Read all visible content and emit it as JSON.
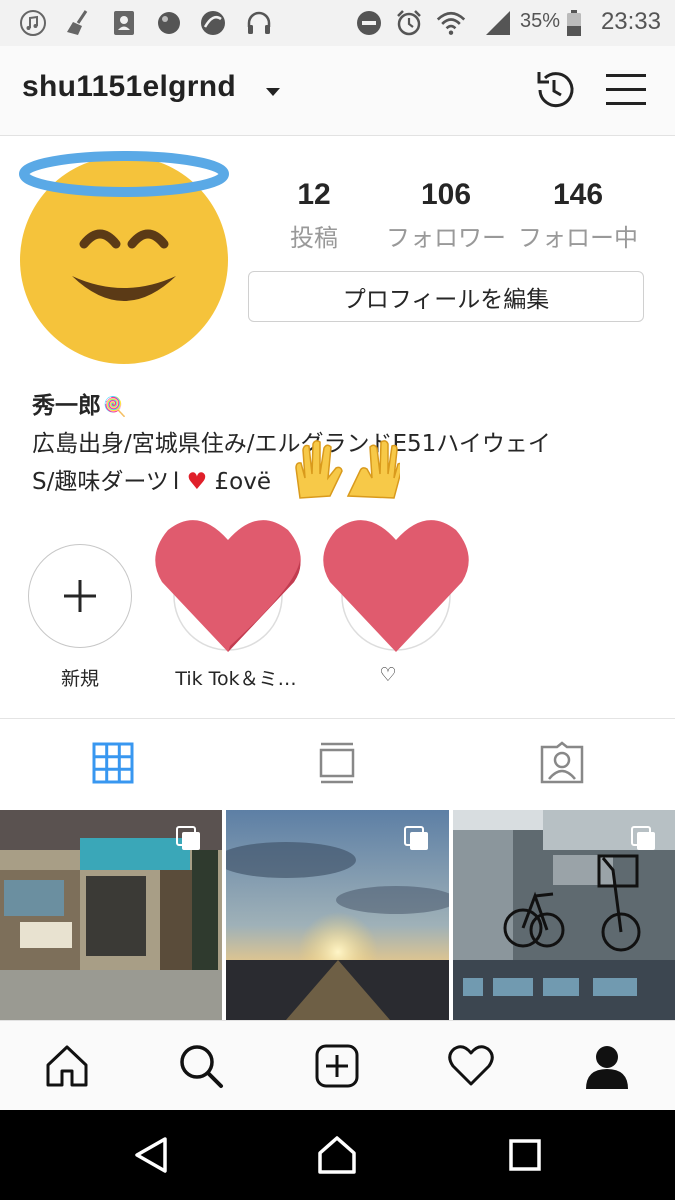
{
  "status_bar": {
    "battery": "35%",
    "time": "23:33",
    "icons": [
      "music-icon",
      "broom-icon",
      "contacts-icon",
      "circle-icon",
      "app-icon",
      "headphones-icon",
      "dnd-icon",
      "alarm-icon",
      "wifi-icon",
      "signal-icon",
      "battery-icon"
    ]
  },
  "header": {
    "username": "shu1151elgrnd",
    "icons": [
      "history-icon",
      "menu-icon"
    ]
  },
  "profile": {
    "stats": [
      {
        "count": "12",
        "label": "投稿"
      },
      {
        "count": "106",
        "label": "フォロワー"
      },
      {
        "count": "146",
        "label": "フォロー中"
      }
    ],
    "edit_button": "プロフィールを編集",
    "display_name": "秀一郎",
    "display_name_emoji": "🍭",
    "bio": {
      "line1": "広島出身/宮城県住み/エルグランドE51ハイウェイ",
      "line2_prefix": "S/趣味ダーツ",
      "line2_heart": "♥",
      "line2_suffix": "£ovë"
    }
  },
  "highlights": [
    {
      "label": "新規"
    },
    {
      "label": "Tik Tok＆ミ…"
    },
    {
      "label": "♡"
    }
  ],
  "tabs": [
    "grid-icon",
    "feed-icon",
    "tagged-icon"
  ],
  "bottom_nav": [
    "home-icon",
    "search-icon",
    "add-icon",
    "heart-icon",
    "profile-icon"
  ],
  "colors": {
    "accent": "#3897f0",
    "heart": "#e05b6e",
    "avatar_face": "#f5c33b",
    "halo": "#5aa9e6"
  }
}
